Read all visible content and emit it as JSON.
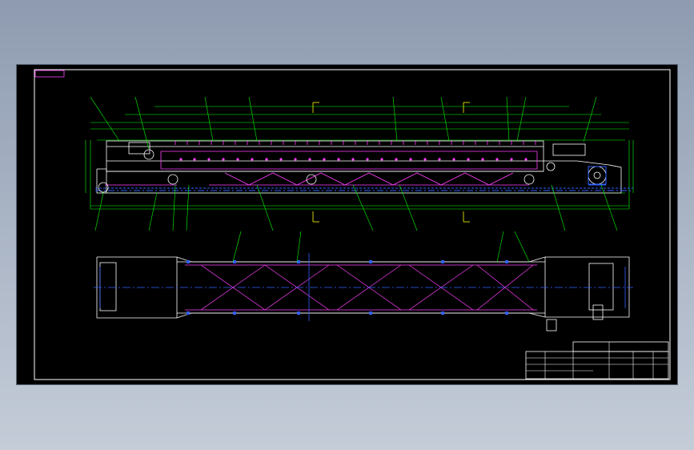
{
  "drawing": {
    "background": "#000000",
    "colors": {
      "frame": "#ffffff",
      "outline": "#ffffff",
      "dimension": "#00ff00",
      "structure": "#ff40ff",
      "center": "#3060ff",
      "leader": "#00ff00",
      "annotation": "#ffff00"
    },
    "sheet_tag": "",
    "note_text": "",
    "title_block": {
      "title": "",
      "drawing_no": "",
      "scale": ""
    }
  }
}
